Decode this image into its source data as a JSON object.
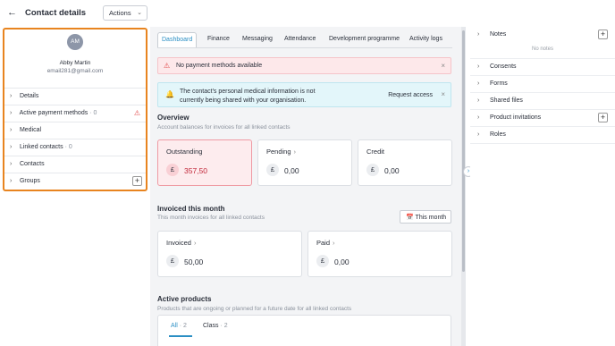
{
  "header": {
    "back_icon": "arrow-left-icon",
    "title": "Contact details",
    "actions_label": "Actions"
  },
  "contact": {
    "initials": "AM",
    "name": "Abby Martin",
    "email": "email281@gmail.com",
    "sections": [
      {
        "label": "Details",
        "count": ""
      },
      {
        "label": "Active payment methods",
        "count": "· 0"
      },
      {
        "label": "Medical",
        "count": ""
      },
      {
        "label": "Linked contacts",
        "count": "· 0"
      },
      {
        "label": "Contacts",
        "count": ""
      },
      {
        "label": "Groups",
        "count": ""
      }
    ]
  },
  "tabs": [
    "Dashboard",
    "Finance",
    "Messaging",
    "Attendance",
    "Development programme",
    "Activity logs"
  ],
  "alerts": {
    "payment": "No payment methods available",
    "medical_line1": "The contact's personal medical information is not",
    "medical_line2": "currently being shared with your organisation.",
    "request_access": "Request access"
  },
  "overview": {
    "title": "Overview",
    "subtitle": "Account balances for invoices for all linked contacts",
    "cards": [
      {
        "label": "Outstanding",
        "currency": "£",
        "value": "357,50"
      },
      {
        "label": "Pending",
        "currency": "£",
        "value": "0,00"
      },
      {
        "label": "Credit",
        "currency": "£",
        "value": "0,00"
      }
    ]
  },
  "invoiced": {
    "title": "Invoiced this month",
    "subtitle": "This month invoices for all linked contacts",
    "period_button": "This month",
    "cards": [
      {
        "label": "Invoiced",
        "currency": "£",
        "value": "50,00"
      },
      {
        "label": "Paid",
        "currency": "£",
        "value": "0,00"
      }
    ]
  },
  "products": {
    "title": "Active products",
    "subtitle": "Products that are ongoing or planned for a future date for all linked contacts",
    "tabs": [
      {
        "label": "All",
        "count": "· 2"
      },
      {
        "label": "Class",
        "count": "· 2"
      }
    ]
  },
  "sidebar_right": {
    "sections": [
      "Notes",
      "Consents",
      "Forms",
      "Shared files",
      "Product invitations",
      "Roles"
    ],
    "no_notes": "No notes"
  },
  "colors": {
    "accent": "#2b8fc4",
    "highlight_border": "#e8841f",
    "danger": "#c2283a"
  }
}
